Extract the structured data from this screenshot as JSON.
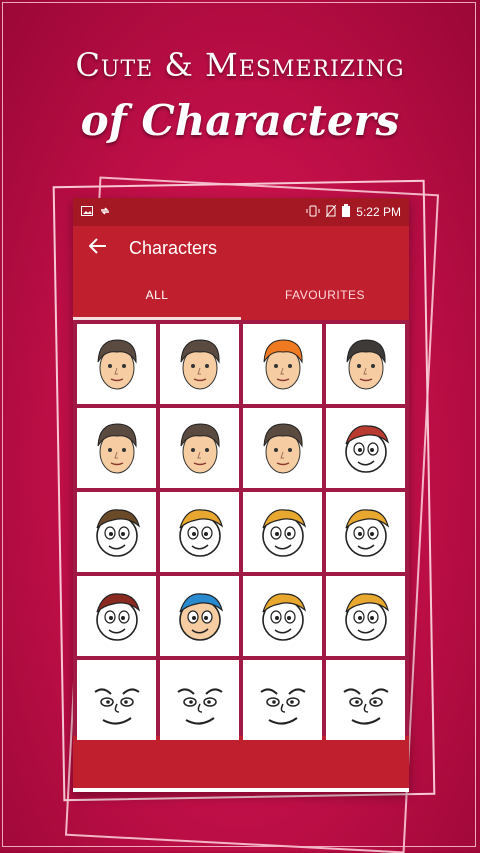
{
  "headline": {
    "line1": "Cute & Mesmerizing",
    "line2": "of Characters"
  },
  "statusbar": {
    "time": "5:22 PM",
    "left_icons": [
      "image-icon",
      "sync-icon"
    ],
    "right_icons": [
      "vibrate-icon",
      "no-sim-icon",
      "battery-icon"
    ]
  },
  "appbar": {
    "title": "Characters",
    "back_icon": "arrow-left-icon"
  },
  "tabs": [
    {
      "label": "ALL",
      "selected": true
    },
    {
      "label": "FAVOURITES",
      "selected": false
    }
  ],
  "characters": [
    {
      "hair": "#5a4a40",
      "skin": "#f6cda3",
      "style": "realistic"
    },
    {
      "hair": "#5a4a40",
      "skin": "#f6cda3",
      "style": "realistic"
    },
    {
      "hair": "#f07a22",
      "skin": "#f6cda3",
      "style": "realistic"
    },
    {
      "hair": "#3e3a38",
      "skin": "#f6cda3",
      "style": "realistic"
    },
    {
      "hair": "#5a4a40",
      "skin": "#f6cda3",
      "style": "realistic"
    },
    {
      "hair": "#5a4a40",
      "skin": "#f6cda3",
      "style": "realistic"
    },
    {
      "hair": "#5a4a40",
      "skin": "#f6cda3",
      "style": "realistic"
    },
    {
      "hair": "#b83a30",
      "skin": "#ffffff",
      "style": "toon"
    },
    {
      "hair": "#6b4a2a",
      "skin": "#ffffff",
      "style": "toon"
    },
    {
      "hair": "#e8a830",
      "skin": "#ffffff",
      "style": "toon"
    },
    {
      "hair": "#e8a830",
      "skin": "#ffffff",
      "style": "toon"
    },
    {
      "hair": "#e8a830",
      "skin": "#ffffff",
      "style": "toon"
    },
    {
      "hair": "#8a2a20",
      "skin": "#ffffff",
      "style": "toon"
    },
    {
      "hair": "#2a8ad0",
      "skin": "#f6cda3",
      "style": "toon"
    },
    {
      "hair": "#e8a830",
      "skin": "#ffffff",
      "style": "toon"
    },
    {
      "hair": "#e8a830",
      "skin": "#ffffff",
      "style": "toon"
    },
    {
      "hair": "#222222",
      "skin": "#ffffff",
      "style": "sketch"
    },
    {
      "hair": "#222222",
      "skin": "#ffffff",
      "style": "sketch"
    },
    {
      "hair": "#222222",
      "skin": "#ffffff",
      "style": "sketch"
    },
    {
      "hair": "#222222",
      "skin": "#ffffff",
      "style": "sketch"
    }
  ]
}
